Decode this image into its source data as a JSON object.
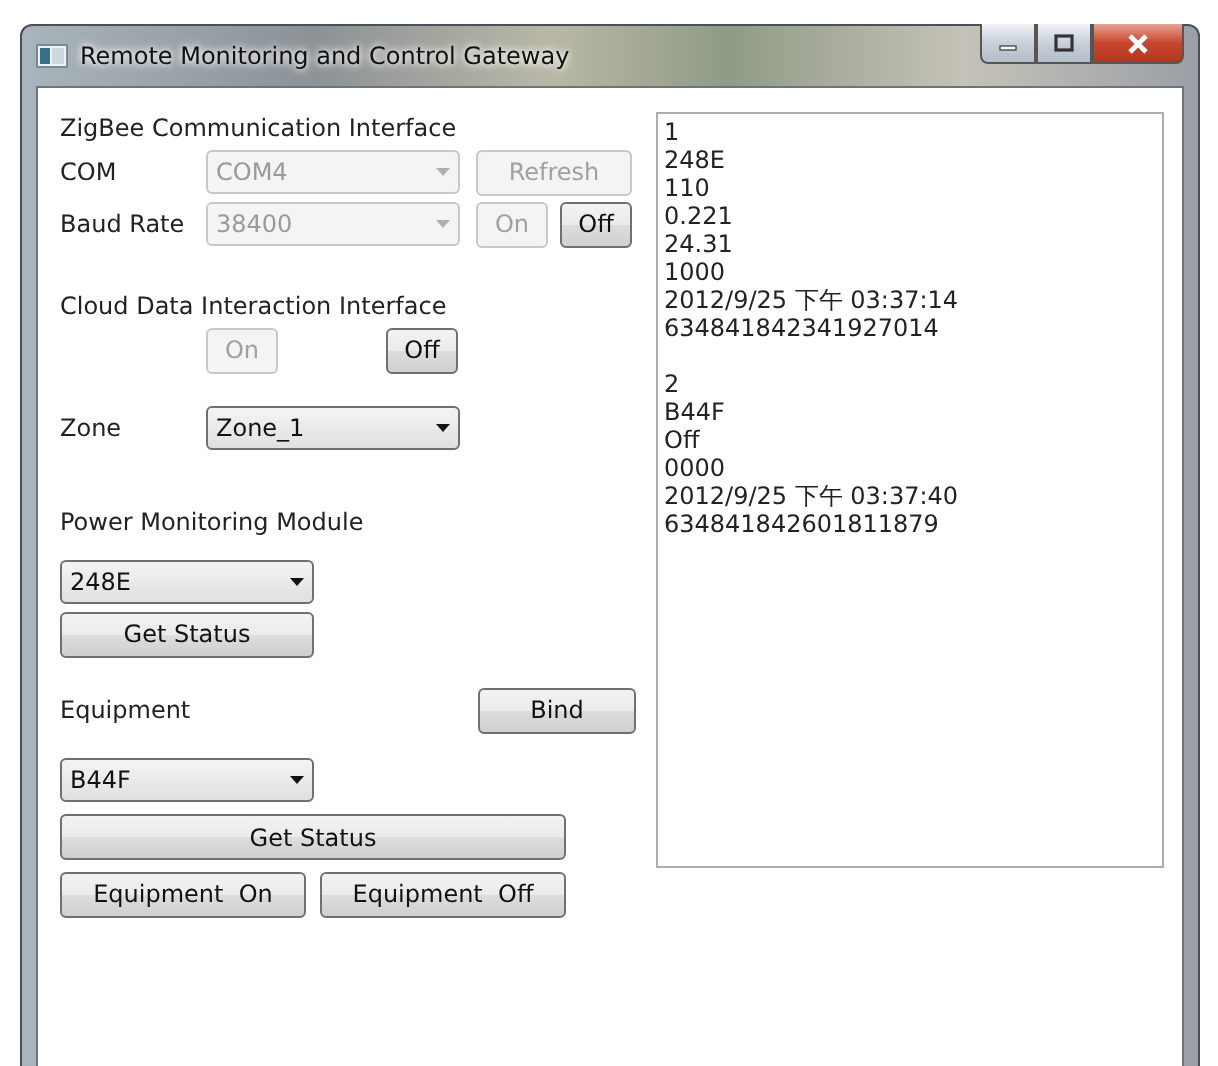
{
  "window": {
    "title": "Remote Monitoring and Control Gateway"
  },
  "zigbee": {
    "title": "ZigBee Communication Interface",
    "com": {
      "label": "COM",
      "value": "COM4",
      "disabled": true
    },
    "refresh": {
      "label": "Refresh",
      "disabled": true
    },
    "baud": {
      "label": "Baud Rate",
      "value": "38400",
      "disabled": true
    },
    "on": {
      "label": "On",
      "disabled": true
    },
    "off": {
      "label": "Off",
      "disabled": false
    }
  },
  "cloud": {
    "title": "Cloud Data Interaction Interface",
    "on": {
      "label": "On",
      "disabled": true
    },
    "off": {
      "label": "Off",
      "disabled": false
    }
  },
  "zone": {
    "label": "Zone",
    "value": "Zone_1"
  },
  "power": {
    "title": "Power Monitoring Module",
    "value": "248E",
    "button": "Get Status"
  },
  "equipment": {
    "title": "Equipment",
    "bind": "Bind",
    "value": "B44F",
    "button": "Get Status",
    "on": "Equipment  On",
    "off": "Equipment  Off"
  },
  "log": [
    {
      "lines": [
        "1",
        "248E",
        "110",
        "0.221",
        "24.31",
        "1000",
        "2012/9/25 下午 03:37:14",
        "634841842341927014"
      ]
    },
    {
      "lines": [
        "2",
        "B44F",
        "Off",
        "0000",
        "2012/9/25 下午 03:37:40",
        "634841842601811879"
      ]
    }
  ]
}
